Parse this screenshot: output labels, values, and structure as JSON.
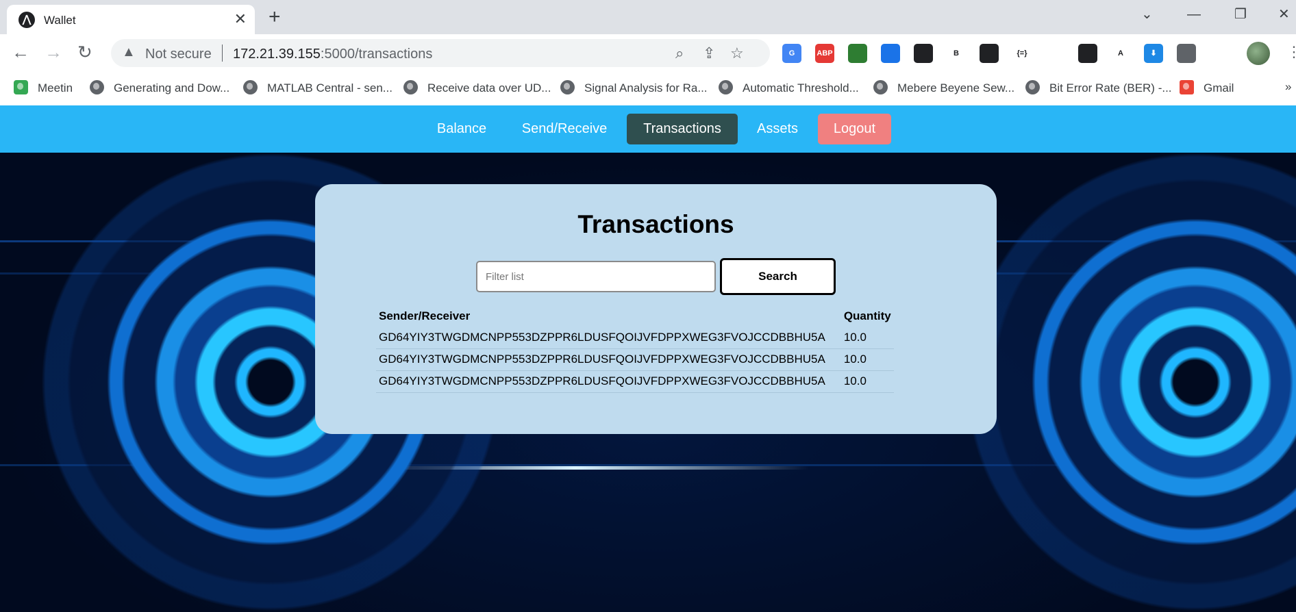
{
  "browser": {
    "tab_title": "Wallet",
    "security_label": "Not secure",
    "url_host": "172.21.39.155",
    "url_path": ":5000/transactions",
    "extensions": [
      {
        "name": "google-translate-extension",
        "label": "G",
        "color": "#4285f4"
      },
      {
        "name": "adblock-plus-extension",
        "label": "ABP",
        "color": "#e53935"
      },
      {
        "name": "globe-extension",
        "label": "",
        "color": "#2e7d32"
      },
      {
        "name": "document-extension",
        "label": "",
        "color": "#1a73e8"
      },
      {
        "name": "copy-extension",
        "label": "",
        "color": "#202124"
      },
      {
        "name": "b-extension",
        "label": "B",
        "color": "#ffffff"
      },
      {
        "name": "cat-extension",
        "label": "",
        "color": "#202124"
      },
      {
        "name": "json-extension",
        "label": "{=}",
        "color": "#ffffff"
      },
      {
        "name": "hand-extension",
        "label": "",
        "color": "#ffffff"
      },
      {
        "name": "picture-in-picture-extension",
        "label": "",
        "color": "#202124"
      },
      {
        "name": "a-extension",
        "label": "A",
        "color": "#ffffff"
      },
      {
        "name": "download-extension",
        "label": "⬇",
        "color": "#1e88e5"
      },
      {
        "name": "puzzle-extension",
        "label": "",
        "color": "#5f6368"
      },
      {
        "name": "side-panel-extension",
        "label": "",
        "color": "#ffffff"
      }
    ],
    "bookmarks": [
      {
        "label": "Meetin",
        "icon": "google-meet-icon"
      },
      {
        "label": "Generating and Dow...",
        "icon": "globe-icon"
      },
      {
        "label": "MATLAB Central - sen...",
        "icon": "globe-icon"
      },
      {
        "label": "Receive data over UD...",
        "icon": "globe-icon"
      },
      {
        "label": "Signal Analysis for Ra...",
        "icon": "globe-icon"
      },
      {
        "label": "Automatic Threshold...",
        "icon": "globe-icon"
      },
      {
        "label": "Mebere Beyene Sew...",
        "icon": "globe-icon"
      },
      {
        "label": "Bit Error Rate (BER) -...",
        "icon": "globe-icon"
      },
      {
        "label": "Gmail",
        "icon": "gmail-icon"
      }
    ],
    "bookmarks_overflow": "»"
  },
  "nav": {
    "items": [
      {
        "label": "Balance"
      },
      {
        "label": "Send/Receive"
      },
      {
        "label": "Transactions"
      },
      {
        "label": "Assets"
      },
      {
        "label": "Logout"
      }
    ],
    "active": "Transactions",
    "colors": {
      "bar": "#29b6f6",
      "active": "#2f4f4f",
      "logout": "#f08080"
    }
  },
  "card": {
    "title": "Transactions",
    "search": {
      "placeholder": "Filter list",
      "value": "",
      "button_label": "Search"
    },
    "table": {
      "headers": [
        "Sender/Receiver",
        "Quantity"
      ],
      "rows": [
        [
          "GD64YIY3TWGDMCNPP553DZPPR6LDUSFQOIJVFDPPXWEG3FVOJCCDBBHU5A",
          "10.0"
        ],
        [
          "GD64YIY3TWGDMCNPP553DZPPR6LDUSFQOIJVFDPPXWEG3FVOJCCDBBHU5A",
          "10.0"
        ],
        [
          "GD64YIY3TWGDMCNPP553DZPPR6LDUSFQOIJVFDPPXWEG3FVOJCCDBBHU5A",
          "10.0"
        ]
      ]
    }
  }
}
